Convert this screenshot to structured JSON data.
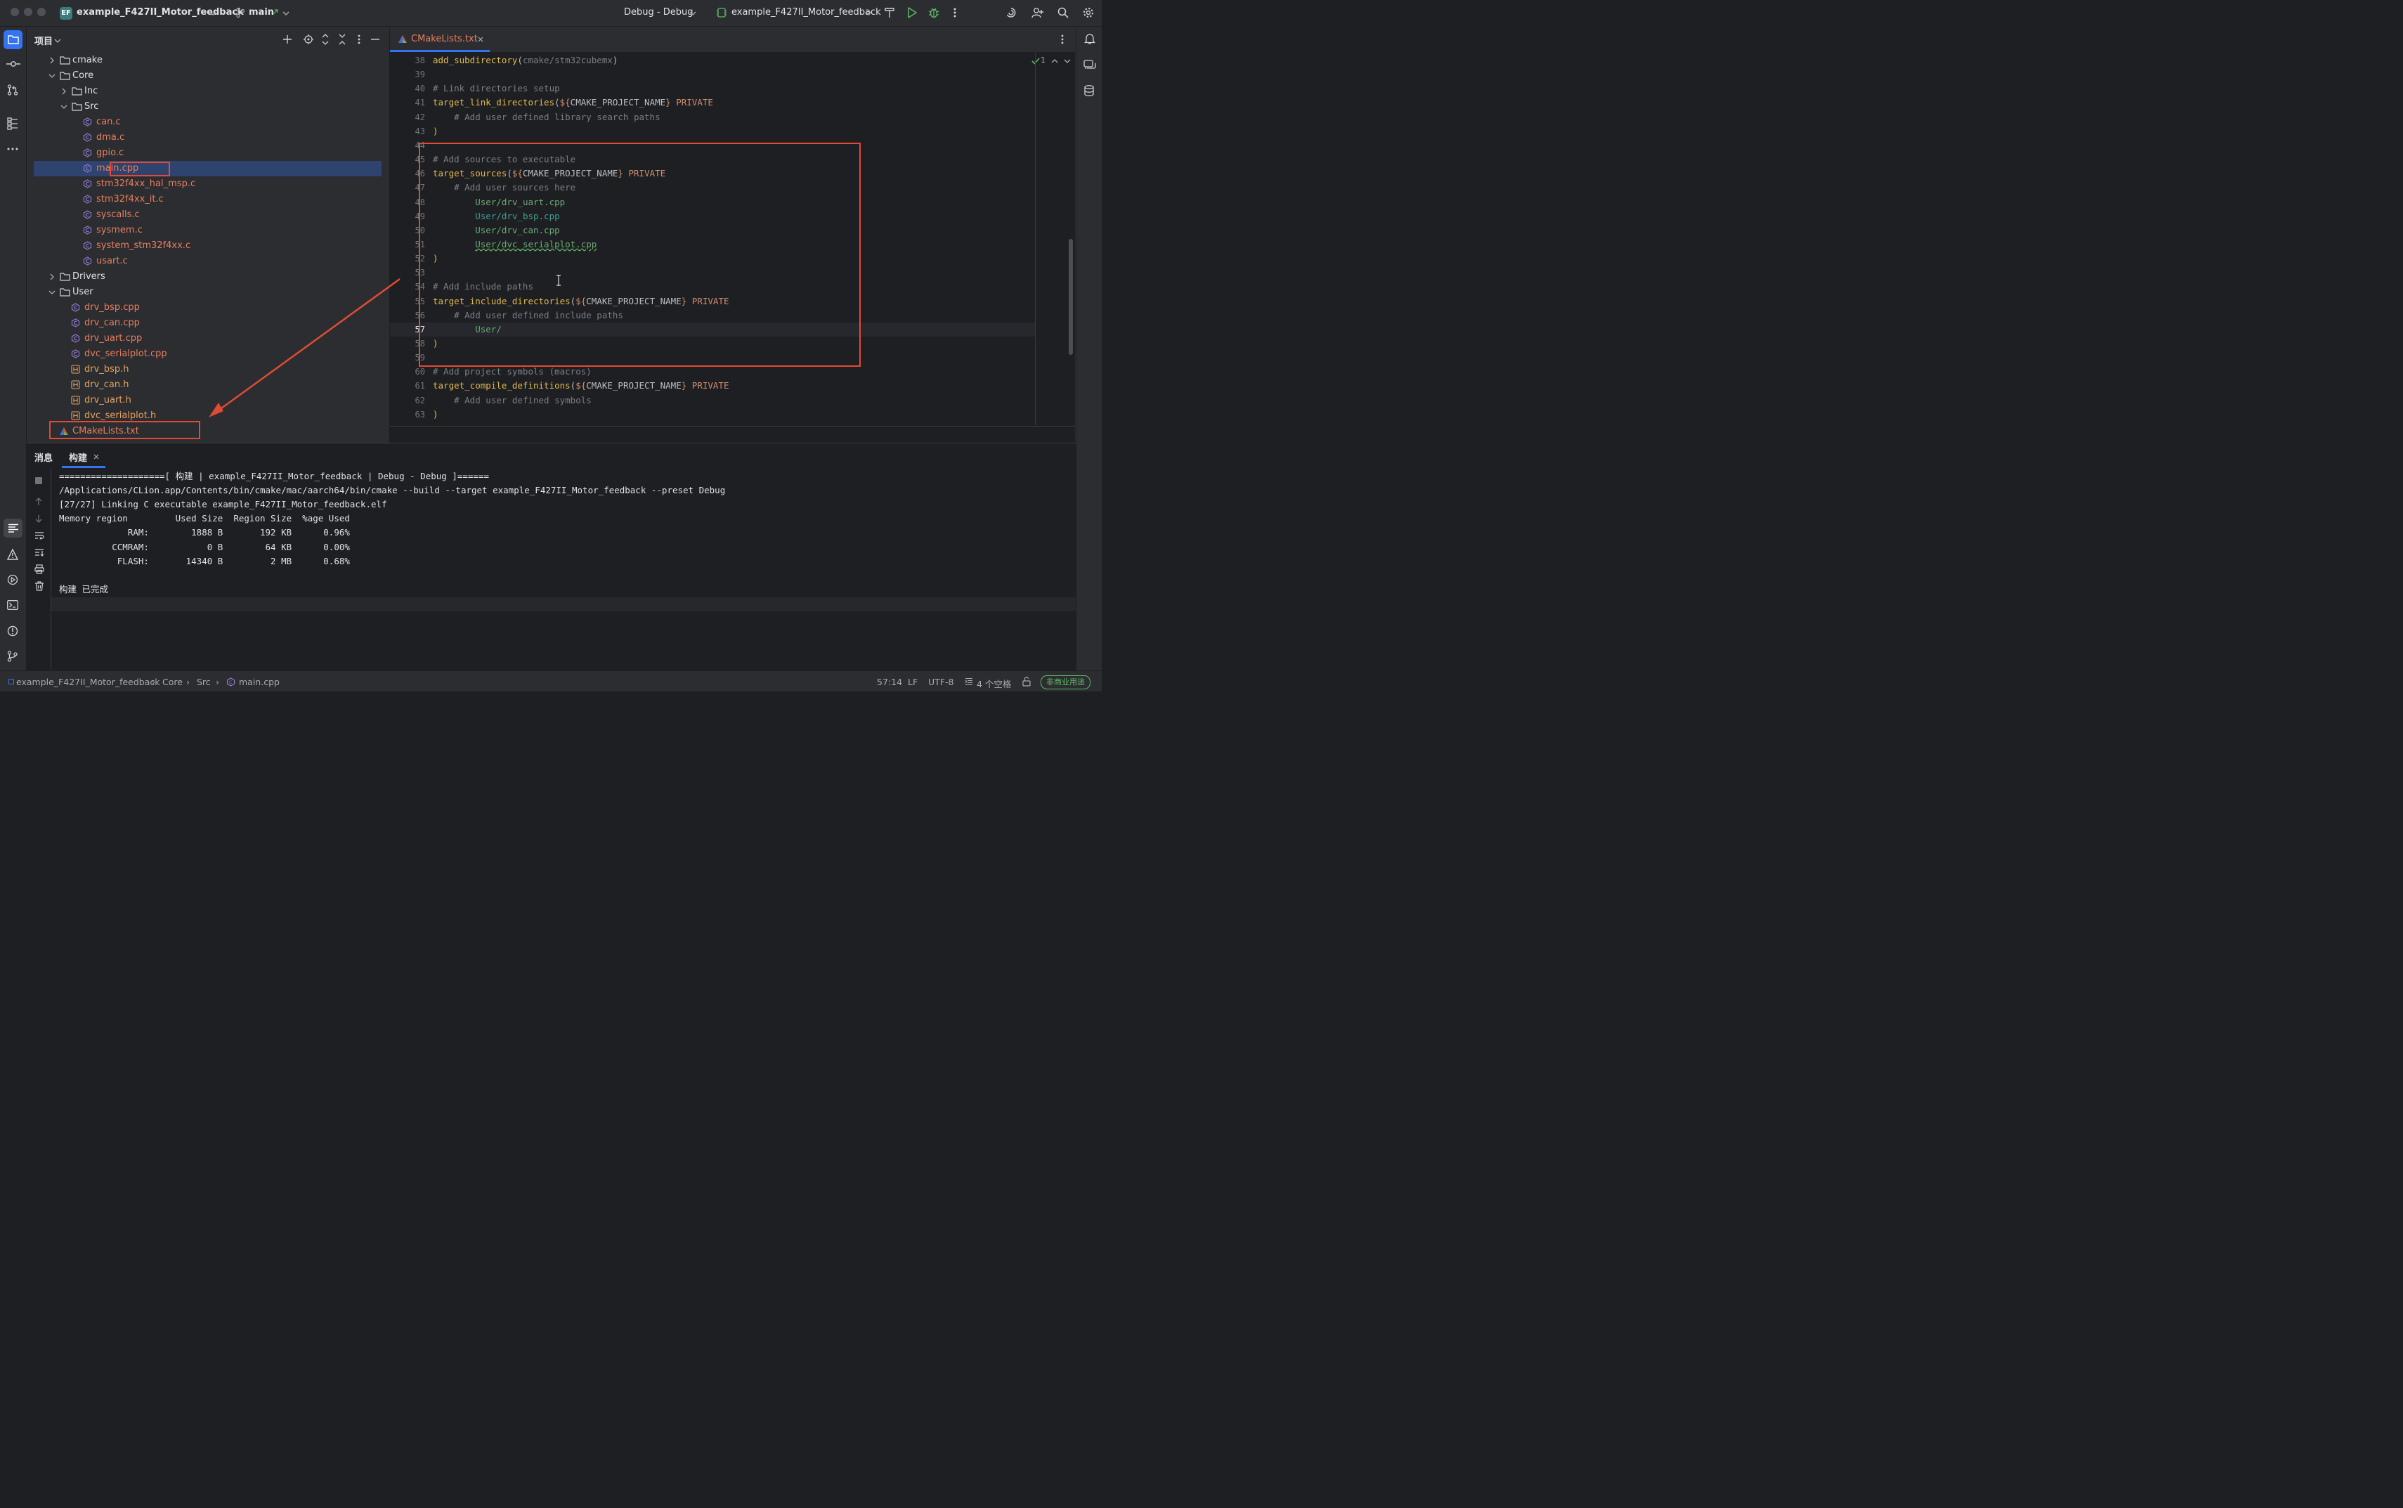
{
  "titlebar": {
    "project_badge": "EF",
    "project_name": "example_F427II_Motor_feedback",
    "branch": "main",
    "run_config": "Debug - Debug",
    "target": "example_F427II_Motor_feedback"
  },
  "project_panel": {
    "title": "项目",
    "items": [
      {
        "label": "cmake",
        "kind": "folder",
        "depth": 0,
        "expanded": false
      },
      {
        "label": "Core",
        "kind": "folder",
        "depth": 0,
        "expanded": true
      },
      {
        "label": "Inc",
        "kind": "folder",
        "depth": 1,
        "expanded": false
      },
      {
        "label": "Src",
        "kind": "folder",
        "depth": 1,
        "expanded": true
      },
      {
        "label": "can.c",
        "kind": "c",
        "depth": 2
      },
      {
        "label": "dma.c",
        "kind": "c",
        "depth": 2
      },
      {
        "label": "gpio.c",
        "kind": "c",
        "depth": 2
      },
      {
        "label": "main.cpp",
        "kind": "cpp",
        "depth": 2,
        "selected": true
      },
      {
        "label": "stm32f4xx_hal_msp.c",
        "kind": "c",
        "depth": 2
      },
      {
        "label": "stm32f4xx_it.c",
        "kind": "c",
        "depth": 2
      },
      {
        "label": "syscalls.c",
        "kind": "c",
        "depth": 2
      },
      {
        "label": "sysmem.c",
        "kind": "c",
        "depth": 2
      },
      {
        "label": "system_stm32f4xx.c",
        "kind": "c",
        "depth": 2
      },
      {
        "label": "usart.c",
        "kind": "c",
        "depth": 2
      },
      {
        "label": "Drivers",
        "kind": "folder",
        "depth": 0,
        "expanded": false
      },
      {
        "label": "User",
        "kind": "folder",
        "depth": 0,
        "expanded": true
      },
      {
        "label": "drv_bsp.cpp",
        "kind": "cpp",
        "depth": 1
      },
      {
        "label": "drv_can.cpp",
        "kind": "cpp",
        "depth": 1
      },
      {
        "label": "drv_uart.cpp",
        "kind": "cpp",
        "depth": 1
      },
      {
        "label": "dvc_serialplot.cpp",
        "kind": "cpp",
        "depth": 1
      },
      {
        "label": "drv_bsp.h",
        "kind": "h",
        "depth": 1
      },
      {
        "label": "drv_can.h",
        "kind": "h",
        "depth": 1
      },
      {
        "label": "drv_uart.h",
        "kind": "h",
        "depth": 1
      },
      {
        "label": "dvc_serialplot.h",
        "kind": "h",
        "depth": 1
      },
      {
        "label": "CMakeLists.txt",
        "kind": "cmake",
        "depth": 0
      }
    ]
  },
  "editor": {
    "tab": "CMakeLists.txt",
    "inspection_count": "1",
    "lines": [
      {
        "n": "38",
        "parts": [
          [
            "fn",
            "add_subdirectory"
          ],
          [
            "p",
            "("
          ],
          [
            "cmt2",
            "cmake/stm32cubemx"
          ],
          [
            "p",
            ")"
          ]
        ]
      },
      {
        "n": "39",
        "parts": []
      },
      {
        "n": "40",
        "parts": [
          [
            "cmt",
            "# Link directories setup"
          ]
        ]
      },
      {
        "n": "41",
        "parts": [
          [
            "fn",
            "target_link_directories"
          ],
          [
            "p",
            "("
          ],
          [
            "kw",
            "${"
          ],
          [
            "p",
            "CMAKE_PROJECT_NAME"
          ],
          [
            "kw",
            "}"
          ],
          [
            "p",
            " "
          ],
          [
            "kw",
            "PRIVATE"
          ]
        ]
      },
      {
        "n": "42",
        "parts": [
          [
            "p",
            "    "
          ],
          [
            "cmt",
            "# Add user defined library search paths"
          ]
        ]
      },
      {
        "n": "43",
        "parts": [
          [
            "fn",
            ")"
          ]
        ]
      },
      {
        "n": "44",
        "parts": []
      },
      {
        "n": "45",
        "parts": [
          [
            "cmt",
            "# Add sources to executable"
          ]
        ]
      },
      {
        "n": "46",
        "parts": [
          [
            "fn",
            "target_sources"
          ],
          [
            "p",
            "("
          ],
          [
            "kw",
            "${"
          ],
          [
            "p",
            "CMAKE_PROJECT_NAME"
          ],
          [
            "kw",
            "}"
          ],
          [
            "p",
            " "
          ],
          [
            "kw",
            "PRIVATE"
          ]
        ]
      },
      {
        "n": "47",
        "parts": [
          [
            "p",
            "    "
          ],
          [
            "cmt",
            "# Add user sources here"
          ]
        ]
      },
      {
        "n": "48",
        "parts": [
          [
            "p",
            "        "
          ],
          [
            "str",
            "User/drv_uart.cpp"
          ]
        ]
      },
      {
        "n": "49",
        "parts": [
          [
            "p",
            "        "
          ],
          [
            "str2",
            "User/drv_bsp.cpp"
          ]
        ]
      },
      {
        "n": "50",
        "parts": [
          [
            "p",
            "        "
          ],
          [
            "str",
            "User/drv_can.cpp"
          ]
        ]
      },
      {
        "n": "51",
        "parts": [
          [
            "p",
            "        "
          ],
          [
            "str",
            "User/dvc_serialplot.cpp"
          ]
        ]
      },
      {
        "n": "52",
        "parts": [
          [
            "fn",
            ")"
          ]
        ]
      },
      {
        "n": "53",
        "parts": []
      },
      {
        "n": "54",
        "parts": [
          [
            "cmt",
            "# Add include paths"
          ]
        ]
      },
      {
        "n": "55",
        "parts": [
          [
            "fn",
            "target_include_directories"
          ],
          [
            "p",
            "("
          ],
          [
            "kw",
            "${"
          ],
          [
            "p",
            "CMAKE_PROJECT_NAME"
          ],
          [
            "kw",
            "}"
          ],
          [
            "p",
            " "
          ],
          [
            "kw",
            "PRIVATE"
          ]
        ]
      },
      {
        "n": "56",
        "parts": [
          [
            "p",
            "    "
          ],
          [
            "cmt",
            "# Add user defined include paths"
          ]
        ]
      },
      {
        "n": "57",
        "parts": [
          [
            "p",
            "        "
          ],
          [
            "str",
            "User/"
          ]
        ]
      },
      {
        "n": "58",
        "parts": [
          [
            "fn",
            ")"
          ]
        ]
      },
      {
        "n": "59",
        "parts": []
      },
      {
        "n": "60",
        "parts": [
          [
            "cmt",
            "# Add project symbols (macros)"
          ]
        ]
      },
      {
        "n": "61",
        "parts": [
          [
            "fn",
            "target_compile_definitions"
          ],
          [
            "p",
            "("
          ],
          [
            "kw",
            "${"
          ],
          [
            "p",
            "CMAKE_PROJECT_NAME"
          ],
          [
            "kw",
            "}"
          ],
          [
            "p",
            " "
          ],
          [
            "kw",
            "PRIVATE"
          ]
        ]
      },
      {
        "n": "62",
        "parts": [
          [
            "p",
            "    "
          ],
          [
            "cmt",
            "# Add user defined symbols"
          ]
        ]
      },
      {
        "n": "63",
        "parts": [
          [
            "fn",
            ")"
          ]
        ]
      }
    ]
  },
  "build_panel": {
    "tab_messages": "消息",
    "tab_build": "构建",
    "output": [
      "====================[ 构建 | example_F427II_Motor_feedback | Debug - Debug ]======",
      "/Applications/CLion.app/Contents/bin/cmake/mac/aarch64/bin/cmake --build --target example_F427II_Motor_feedback --preset Debug",
      "[27/27] Linking C executable example_F427II_Motor_feedback.elf",
      "Memory region         Used Size  Region Size  %age Used",
      "             RAM:        1888 B       192 KB      0.96%",
      "          CCMRAM:           0 B        64 KB      0.00%",
      "           FLASH:       14340 B         2 MB      0.68%",
      "",
      "构建 已完成"
    ]
  },
  "statusbar": {
    "breadcrumb": [
      "example_F427II_Motor_feedback",
      "Core",
      "Src",
      "main.cpp"
    ],
    "position": "57:14",
    "line_sep": "LF",
    "encoding": "UTF-8",
    "indent": "4 个空格",
    "license": "非商业用途"
  }
}
